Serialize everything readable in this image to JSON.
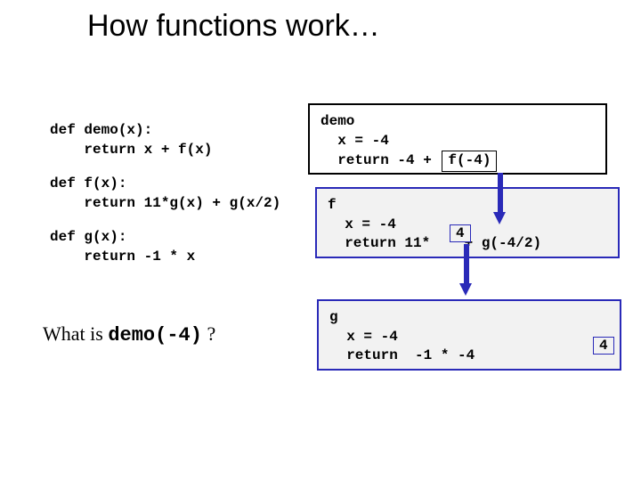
{
  "title": "How functions work…",
  "code": {
    "demo": "def demo(x):\n    return x + f(x)",
    "f": "def f(x):\n    return 11*g(x) + g(x/2)",
    "g": "def g(x):\n    return -1 * x"
  },
  "question_prefix": "What is ",
  "question_call": "demo(-4)",
  "question_suffix": " ?",
  "frames": {
    "demo": {
      "name": "demo",
      "line1": "  x = -4",
      "line2a": "  return -4 + ",
      "line2_boxed": "f(-4)"
    },
    "f": {
      "name": "f",
      "line1": "  x = -4",
      "line2a": "  return 11*",
      "line2_boxed": "4",
      "line2b": "  + g(-4/2)"
    },
    "g": {
      "name": "g",
      "line1": "  x = -4",
      "line2": "  return  -1 * -4"
    }
  },
  "result_bottom": "4"
}
